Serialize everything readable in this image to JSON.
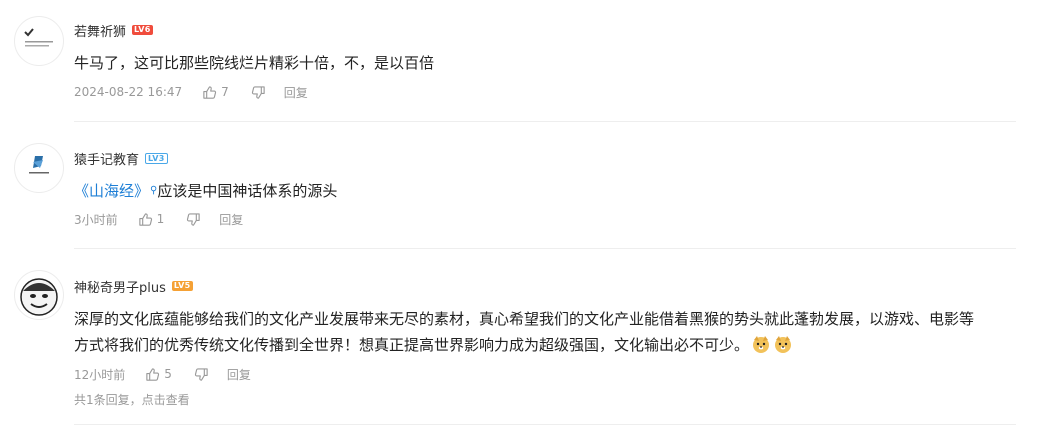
{
  "comments": [
    {
      "username": "若舞祈狮",
      "level": "LV6",
      "text": "牛马了，这可比那些院线烂片精彩十倍，不，是以百倍",
      "time": "2024-08-22 16:47",
      "likes": "7",
      "reply_label": "回复",
      "level_color": "#f04c3c"
    },
    {
      "username": "猿手记教育",
      "level": "LV3",
      "link_text": "《山海经》",
      "text": "应该是中国神话体系的源头",
      "time": "3小时前",
      "likes": "1",
      "reply_label": "回复",
      "level_color": "#4aa8e8"
    },
    {
      "username": "神秘奇男子plus",
      "level": "LV5",
      "text_line1": "深厚的文化底蕴能够给我们的文化产业发展带来无尽的素材，真心希望我们的文化产业能借着黑猴的势头就此蓬勃发展，以游戏、电影等",
      "text_line2": "方式将我们的优秀传统文化传播到全世界！想真正提高世界影响力成为超级强国，文化输出必不可少。",
      "time": "12小时前",
      "likes": "5",
      "reply_label": "回复",
      "replies_summary": "共1条回复，点击查看",
      "level_color": "#f5a135"
    }
  ]
}
